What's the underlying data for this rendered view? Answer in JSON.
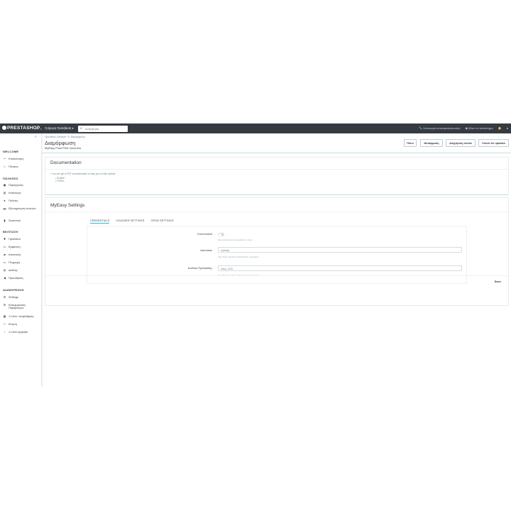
{
  "topbar": {
    "logo": "PRESTASHOP",
    "version": "1.7.8",
    "quick_access": "Γρήγορη Πρόσβαση ▾",
    "search_placeholder": "Αναζήτηση",
    "shop_link": "Λειτουργία αποσφαλμάτωσης",
    "view_shop": "Άδειο το κατάστημα"
  },
  "sidebar": {
    "collapse": "«",
    "sections": [
      {
        "title": "WELCOME",
        "items": [
          {
            "icon": "chart-icon",
            "label": "Επισκόπηση"
          },
          {
            "icon": "home-icon",
            "label": "Πίνακας"
          }
        ]
      },
      {
        "title": "ΠΩΛΗΣΕΙΣ",
        "items": [
          {
            "icon": "cart-icon",
            "label": "Παραγγελίες"
          },
          {
            "icon": "store-icon",
            "label": "Κατάλογος"
          },
          {
            "icon": "user-icon",
            "label": "Πελάτες"
          },
          {
            "icon": "chat-icon",
            "label": "Εξυπηρέτηση πελατών"
          },
          {
            "icon": "stats-icon",
            "label": "Στατιστικά"
          }
        ]
      },
      {
        "title": "ΒΕΛΤΙΩΣΗ",
        "items": [
          {
            "icon": "puzzle-icon",
            "label": "Πρόσθετα"
          },
          {
            "icon": "desktop-icon",
            "label": "Εμφάνιση"
          },
          {
            "icon": "truck-icon",
            "label": "Αποστολή"
          },
          {
            "icon": "card-icon",
            "label": "Πληρωμή"
          },
          {
            "icon": "globe-icon",
            "label": "Διεθνής"
          },
          {
            "icon": "megaphone-icon",
            "label": "Προωθήσεις"
          }
        ]
      },
      {
        "title": "ΔΙΑΜΟΡΦΩΣΗ",
        "items": [
          {
            "icon": "gear-icon",
            "label": "Settings"
          },
          {
            "icon": "gear-icon",
            "label": "Καταχωρήσεις Παραμέτρων"
          },
          {
            "icon": "grid-icon",
            "label": "1-Click / Αναβάθμιση"
          },
          {
            "icon": "chart-icon",
            "label": "Κίνηση"
          },
          {
            "icon": "upgrade-icon",
            "label": "1-Click Upgrade"
          }
        ]
      }
    ]
  },
  "header": {
    "breadcrumb": "Πρόσθετα  /  Module  /  ↻ διαμόρφωση",
    "title": "Διαμόρφωση",
    "subtitle": "MyEasy Fluid Print Vouchers",
    "buttons": [
      "Πίσω",
      "Μετάφραση",
      "Διαχείριση hooks",
      "Check for updates"
    ]
  },
  "documentation": {
    "title": "Documentation",
    "text": "• You can get a PDF documentation to help you on this module",
    "links": [
      "• English",
      "• French"
    ]
  },
  "settings": {
    "title": "MyEasy Settings",
    "tabs": [
      "CREDENTIALS",
      "VOUCHER SETTINGS",
      "CRON SETTINGS"
    ],
    "fields": [
      {
        "label": "Environment",
        "type": "toggle",
        "help": "Set environment (to sandbox or live)"
      },
      {
        "label": "Username",
        "type": "input",
        "value": "myeasy",
        "help": "Your Print Voucher Authorization username"
      },
      {
        "label": "Κωδικός Πρόσβασης",
        "type": "input",
        "value": "easy_1100",
        "help": "Your Print Voucher Authorization password"
      }
    ],
    "save": "Save"
  }
}
